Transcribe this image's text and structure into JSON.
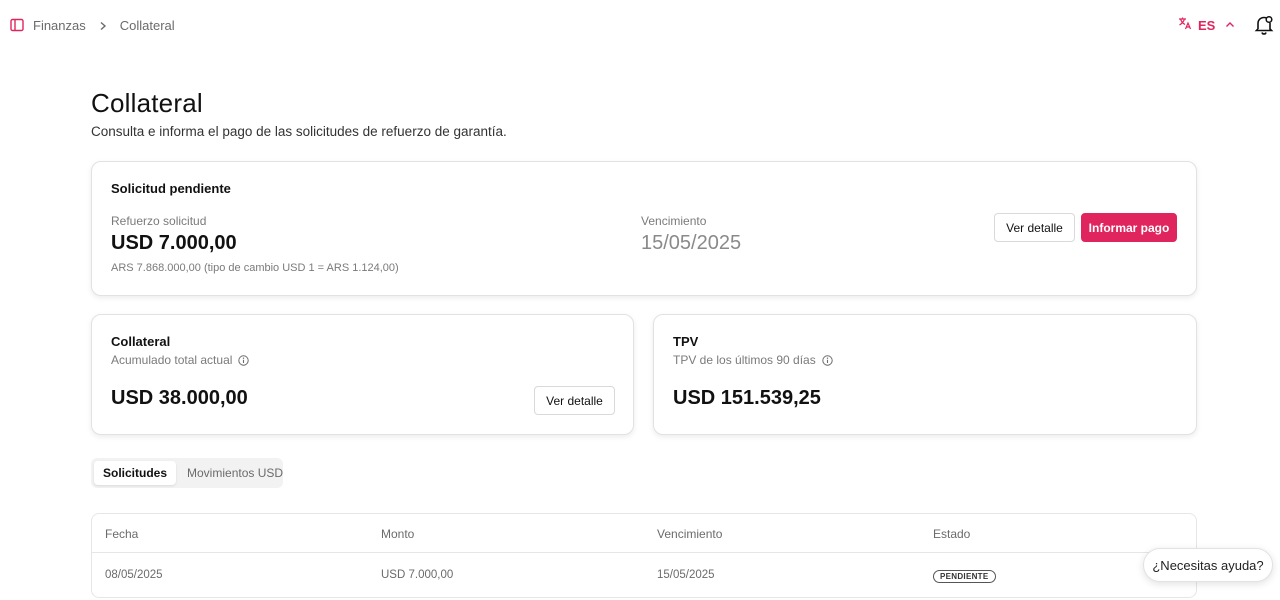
{
  "topbar": {
    "breadcrumb": [
      "Finanzas",
      "Collateral"
    ],
    "language": "ES",
    "icons": {
      "sidebar": "sidebar-toggle-icon",
      "separator": "chevron-right-icon",
      "translate": "translate-icon",
      "lang_chevron": "chevron-up-icon",
      "notifications": "bell-icon"
    }
  },
  "header": {
    "title": "Collateral",
    "subtitle": "Consulta e informa el pago de las solicitudes de refuerzo de garantía."
  },
  "pending": {
    "heading": "Solicitud pendiente",
    "reinforcement_label": "Refuerzo solicitud",
    "reinforcement_amount": "USD 7.000,00",
    "ars_note": "ARS 7.868.000,00 (tipo de cambio USD 1 = ARS 1.124,00)",
    "due_label": "Vencimiento",
    "due_date": "15/05/2025",
    "detail_button": "Ver detalle",
    "pay_button": "Informar pago"
  },
  "collateral": {
    "heading": "Collateral",
    "label": "Acumulado total actual",
    "amount": "USD 38.000,00",
    "detail_button": "Ver detalle"
  },
  "tpv": {
    "heading": "TPV",
    "label": "TPV de los últimos 90 días",
    "amount": "USD 151.539,25"
  },
  "tabs": [
    {
      "label": "Solicitudes",
      "active": true
    },
    {
      "label": "Movimientos USD",
      "active": false
    }
  ],
  "table": {
    "columns": [
      "Fecha",
      "Monto",
      "Vencimiento",
      "Estado"
    ],
    "rows": [
      {
        "fecha": "08/05/2025",
        "monto": "USD 7.000,00",
        "vencimiento": "15/05/2025",
        "estado": "PENDIENTE"
      }
    ]
  },
  "help": {
    "label": "¿Necesitas ayuda?"
  },
  "colors": {
    "accent": "#e0245e",
    "text": "#111111",
    "muted": "#7a7a7a",
    "border": "#e2e2e2"
  }
}
